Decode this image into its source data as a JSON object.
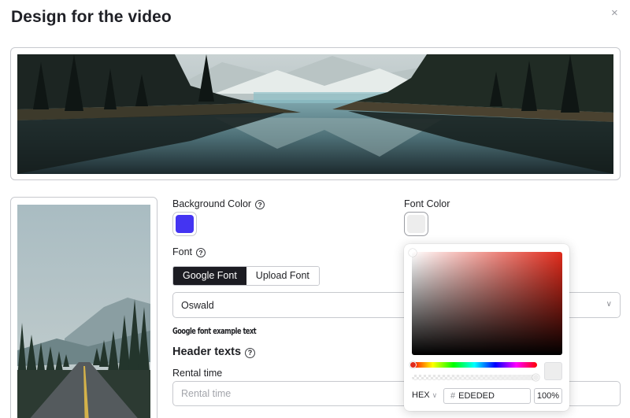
{
  "dialog": {
    "title": "Design for the video",
    "close_glyph": "×",
    "close_icon": "close-icon"
  },
  "form": {
    "background_color": {
      "label": "Background Color",
      "help": "?",
      "value": "#4434f2"
    },
    "font_color": {
      "label": "Font Color",
      "value": "#ededed"
    },
    "font": {
      "label": "Font",
      "help": "?",
      "tabs": [
        "Google Font",
        "Upload Font"
      ],
      "active_tab": "Google Font",
      "selected": "Oswald",
      "chevron_icon": "chevron-down-icon",
      "example_text": "Google font example text"
    },
    "header_texts": {
      "title": "Header texts",
      "help": "?"
    },
    "rental_time": {
      "label": "Rental time",
      "placeholder": "Rental time",
      "value": ""
    }
  },
  "color_picker": {
    "hue_color": "#e02a1b",
    "mode": "HEX",
    "mode_caret": "∨",
    "hash": "#",
    "hex_value": "EDEDED",
    "opacity": "100%"
  },
  "images": {
    "banner": "mountain-lake-reflection-image",
    "portrait": "forest-road-image"
  }
}
